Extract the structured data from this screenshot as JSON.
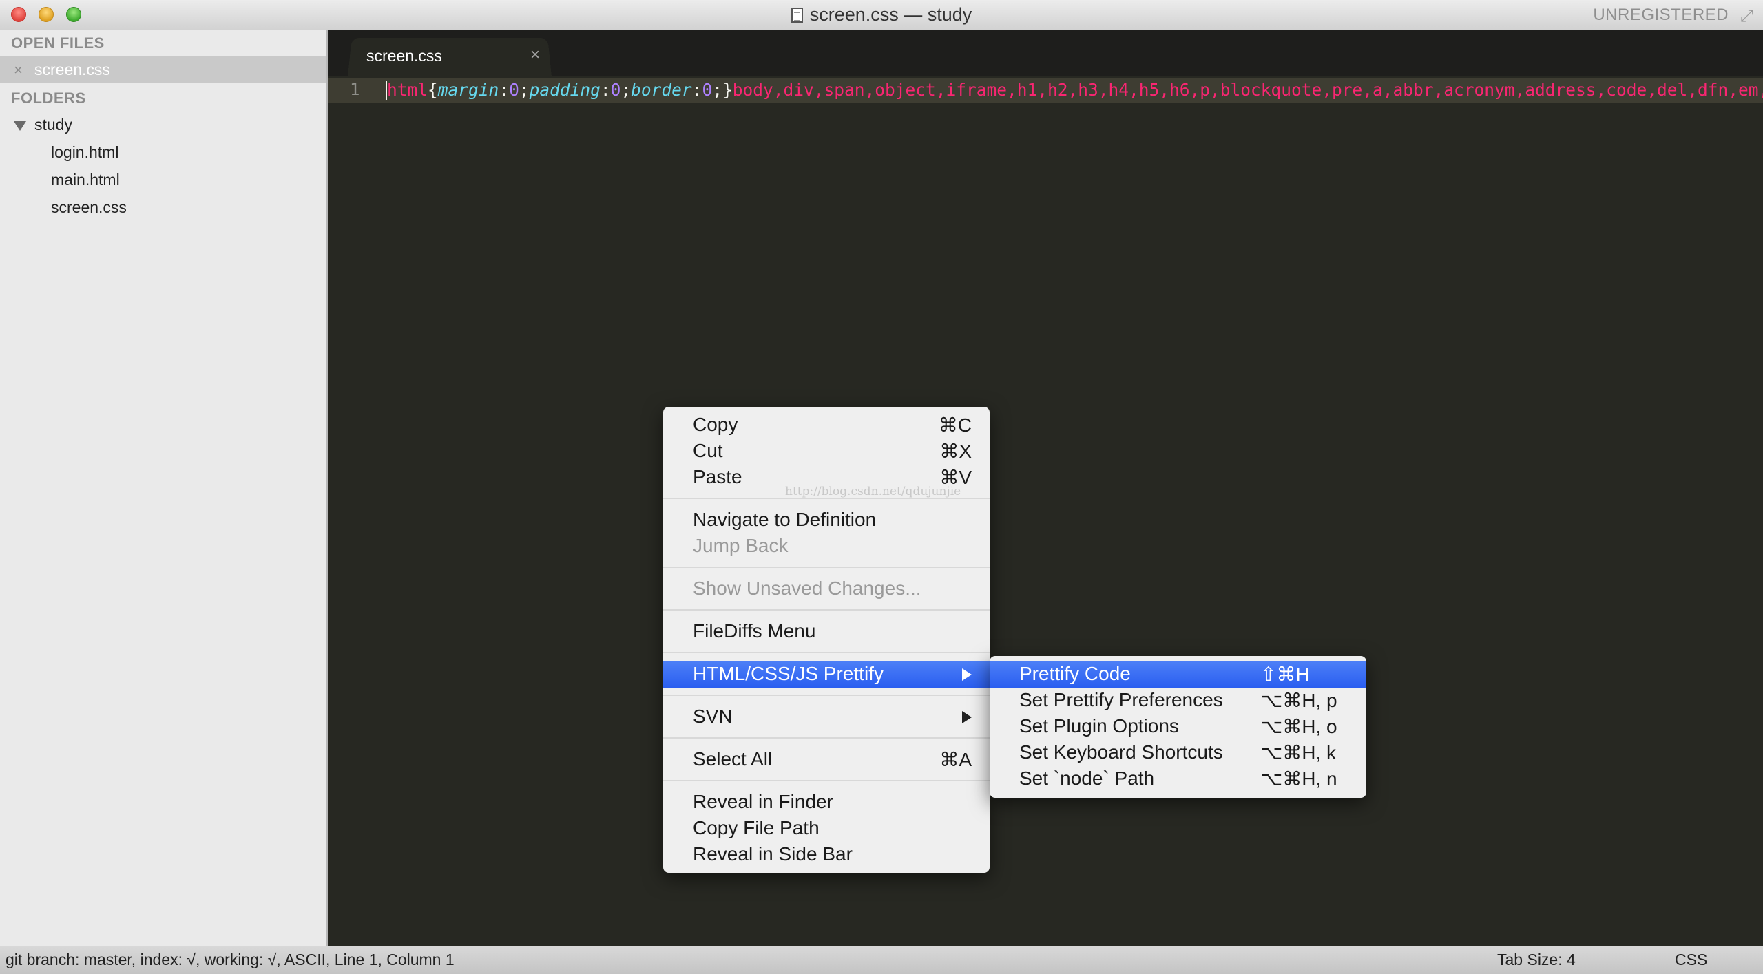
{
  "window": {
    "title": "screen.css — study",
    "registration": "UNREGISTERED"
  },
  "sidebar": {
    "open_files_heading": "OPEN FILES",
    "open_files": [
      {
        "label": "screen.css",
        "close": "×"
      }
    ],
    "folders_heading": "FOLDERS",
    "folder": {
      "label": "study",
      "files": [
        "login.html",
        "main.html",
        "screen.css"
      ]
    }
  },
  "tabs": [
    {
      "label": "screen.css",
      "close": "×"
    }
  ],
  "editor": {
    "line_number": "1",
    "code_tokens": {
      "t1": "html",
      "t2": "{",
      "t3": "margin",
      "t4": ":",
      "t5": "0",
      "t6": ";",
      "t7": "padding",
      "t8": ":",
      "t9": "0",
      "t10": ";",
      "t11": "border",
      "t12": ":",
      "t13": "0",
      "t14": ";}",
      "t15": "body,div,span,object,iframe,h1,h2,h3,h4,h5,h6,p,blockquote,pre,a,abbr,acronym,address,code,del,dfn,em,img,q,d"
    }
  },
  "context_menu": {
    "items": [
      {
        "label": "Copy",
        "shortcut": "⌘C"
      },
      {
        "label": "Cut",
        "shortcut": "⌘X"
      },
      {
        "label": "Paste",
        "shortcut": "⌘V"
      },
      {
        "label": "Navigate to Definition"
      },
      {
        "label": "Jump Back",
        "disabled": true
      },
      {
        "label": "Show Unsaved Changes...",
        "disabled": true
      },
      {
        "label": "FileDiffs Menu"
      },
      {
        "label": "HTML/CSS/JS Prettify",
        "submenu": true,
        "highlighted": true
      },
      {
        "label": "SVN",
        "submenu": true
      },
      {
        "label": "Select All",
        "shortcut": "⌘A"
      },
      {
        "label": "Reveal in Finder"
      },
      {
        "label": "Copy File Path"
      },
      {
        "label": "Reveal in Side Bar"
      }
    ],
    "watermark": "http://blog.csdn.net/qdujunjie"
  },
  "submenu": {
    "items": [
      {
        "label": "Prettify Code",
        "shortcut": "⇧⌘H",
        "highlighted": true
      },
      {
        "label": "Set Prettify Preferences",
        "shortcut": "⌥⌘H, p"
      },
      {
        "label": "Set Plugin Options",
        "shortcut": "⌥⌘H, o"
      },
      {
        "label": "Set Keyboard Shortcuts",
        "shortcut": "⌥⌘H, k"
      },
      {
        "label": "Set `node` Path",
        "shortcut": "⌥⌘H, n"
      }
    ]
  },
  "statusbar": {
    "left": "git branch: master, index: √, working: √, ASCII, Line 1, Column 1",
    "tab_size": "Tab Size: 4",
    "syntax": "CSS"
  },
  "colors": {
    "editor_bg": "#272822",
    "tag": "#f92672",
    "property": "#66d9ef",
    "number": "#ae81ff",
    "menu_highlight": "#3a6ef5"
  }
}
